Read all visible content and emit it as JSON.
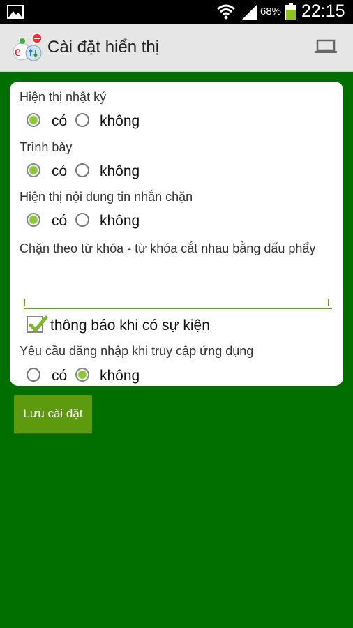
{
  "status_bar": {
    "battery_percent": "68%",
    "time": "22:15"
  },
  "header": {
    "title": "Cài đặt hiển thị"
  },
  "settings": {
    "show_log": {
      "label": "Hiện thị nhật ký",
      "yes_label": "có",
      "no_label": "không",
      "selected": "yes"
    },
    "presentation": {
      "label": "Trình bày",
      "yes_label": "có",
      "no_label": "không",
      "selected": "yes"
    },
    "show_blocked_content": {
      "label": "Hiện thị nội dung tin nhắn chặn",
      "yes_label": "có",
      "no_label": "không",
      "selected": "yes"
    },
    "keyword_block": {
      "label": "Chặn theo từ khóa - từ khóa cắt nhau bằng dấu phẩy",
      "value": ""
    },
    "notify_on_event": {
      "label": "thông báo khi có sự kiện",
      "checked": true
    },
    "require_login": {
      "label": "Yêu cầu đăng nhập khi truy cập ứng dụng",
      "yes_label": "có",
      "no_label": "không",
      "selected": "no"
    }
  },
  "actions": {
    "save_label": "Lưu cài đặt"
  },
  "colors": {
    "background": "#006f00",
    "accent": "#5d9a0e"
  }
}
